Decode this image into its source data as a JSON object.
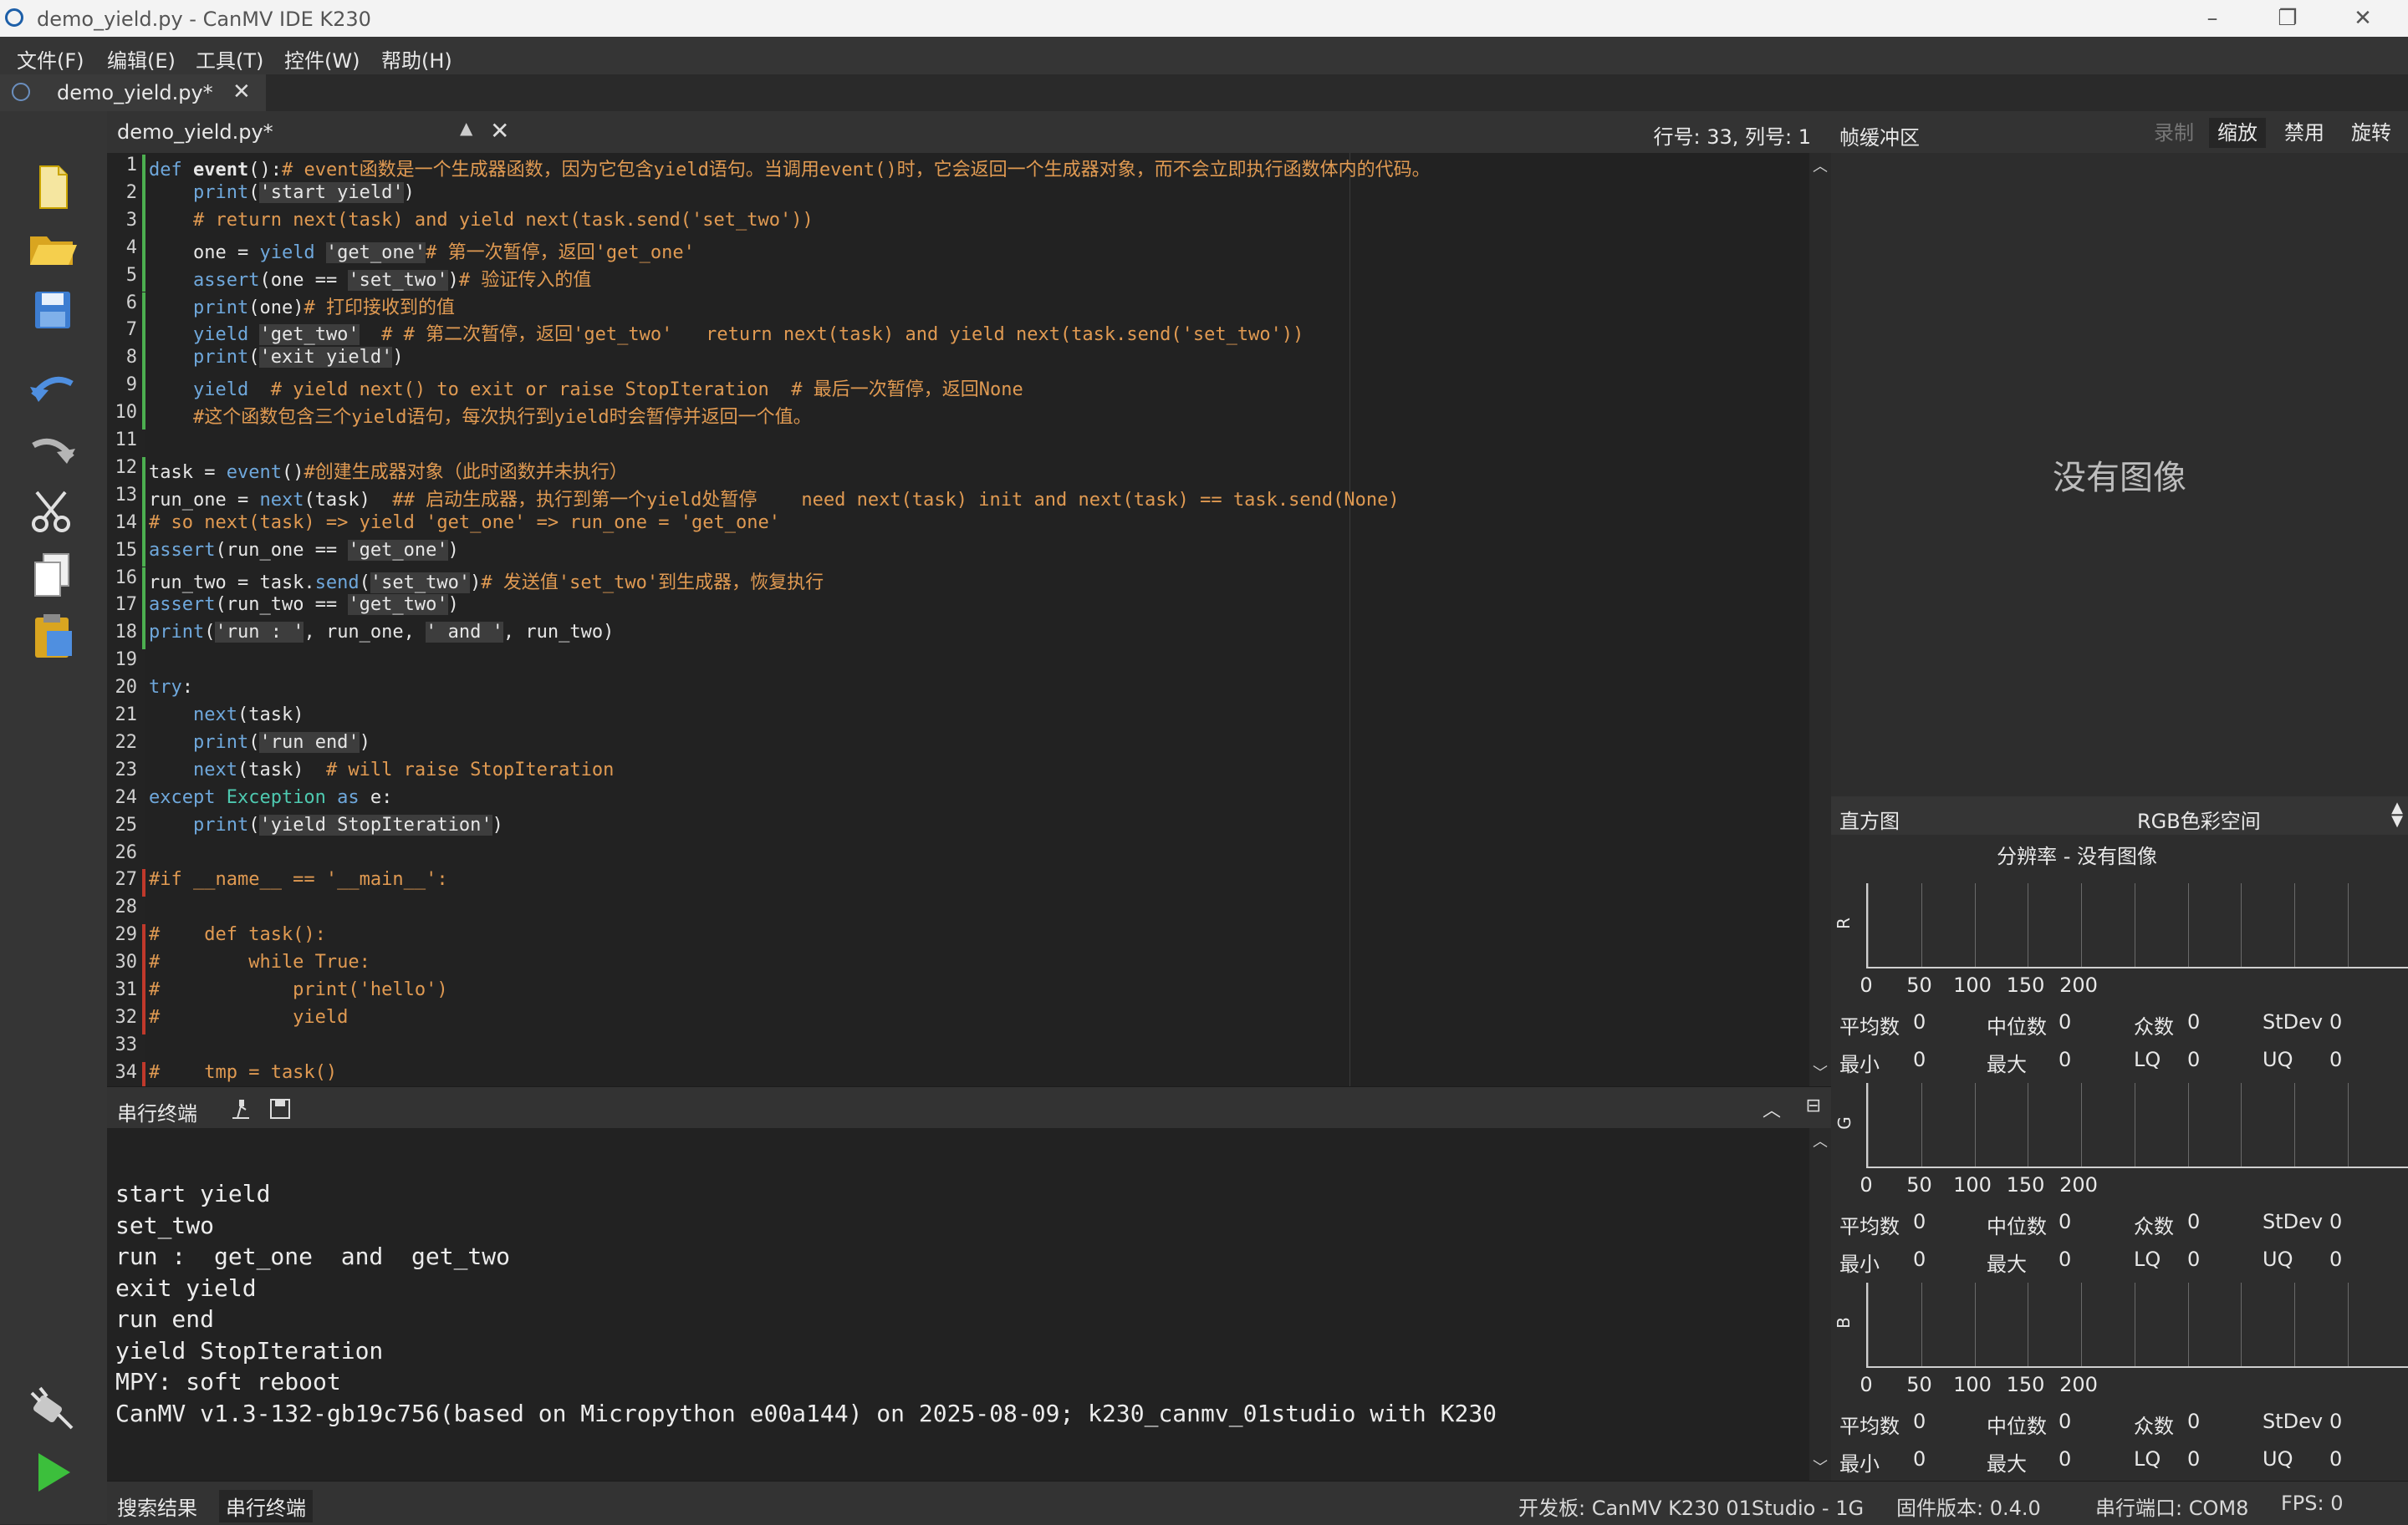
{
  "window": {
    "title": "demo_yield.py - CanMV IDE K230"
  },
  "menu": [
    "文件(F)",
    "编辑(E)",
    "工具(T)",
    "控件(W)",
    "帮助(H)"
  ],
  "file_tab": {
    "label": "demo_yield.py*"
  },
  "editor": {
    "file_name": "demo_yield.py*",
    "position": "行号: 33, 列号: 1",
    "line_numbers": [
      "1",
      "2",
      "3",
      "4",
      "5",
      "6",
      "7",
      "8",
      "9",
      "10",
      "11",
      "12",
      "13",
      "14",
      "15",
      "16",
      "17",
      "18",
      "19",
      "20",
      "21",
      "22",
      "23",
      "24",
      "25",
      "26",
      "27",
      "28",
      "29",
      "30",
      "31",
      "32",
      "33",
      "34"
    ],
    "lines": [
      [
        [
          "kw",
          "def "
        ],
        [
          "fn",
          "event"
        ],
        [
          "",
          "():"
        ],
        [
          "cm",
          "# event函数是一个生成器函数，因为它包含yield语句。当调用event()时，它会返回一个生成器对象，而不会立即执行函数体内的代码。"
        ]
      ],
      [
        [
          "",
          "    "
        ],
        [
          "bi",
          "print"
        ],
        [
          "",
          "("
        ],
        [
          "st",
          "'start yield'"
        ],
        [
          "",
          ")"
        ]
      ],
      [
        [
          "",
          "    "
        ],
        [
          "cm",
          "# return next(task) and yield next(task.send('set_two'))"
        ]
      ],
      [
        [
          "",
          "    one = "
        ],
        [
          "kw",
          "yield "
        ],
        [
          "st",
          "'get_one'"
        ],
        [
          "cm",
          "# 第一次暂停，返回'get_one'"
        ]
      ],
      [
        [
          "",
          "    "
        ],
        [
          "kw",
          "assert"
        ],
        [
          "",
          "(one == "
        ],
        [
          "st",
          "'set_two'"
        ],
        [
          "",
          ")"
        ],
        [
          "cm",
          "# 验证传入的值"
        ]
      ],
      [
        [
          "",
          "    "
        ],
        [
          "bi",
          "print"
        ],
        [
          "",
          "(one)"
        ],
        [
          "cm",
          "# 打印接收到的值"
        ]
      ],
      [
        [
          "",
          "    "
        ],
        [
          "kw",
          "yield "
        ],
        [
          "st",
          "'get_two'"
        ],
        [
          "cm",
          "  # # 第二次暂停，返回'get_two'   return next(task) and yield next(task.send('set_two'))"
        ]
      ],
      [
        [
          "",
          "    "
        ],
        [
          "bi",
          "print"
        ],
        [
          "",
          "("
        ],
        [
          "st",
          "'exit yield'"
        ],
        [
          "",
          ")"
        ]
      ],
      [
        [
          "",
          "    "
        ],
        [
          "kw",
          "yield"
        ],
        [
          "cm",
          "  # yield next() to exit or raise StopIteration  # 最后一次暂停，返回None"
        ]
      ],
      [
        [
          "",
          "    "
        ],
        [
          "cm",
          "#这个函数包含三个yield语句，每次执行到yield时会暂停并返回一个值。"
        ]
      ],
      [],
      [
        [
          "",
          "task = "
        ],
        [
          "bi",
          "event"
        ],
        [
          "",
          "()"
        ],
        [
          "cm",
          "#创建生成器对象（此时函数并未执行）"
        ]
      ],
      [
        [
          "",
          "run_one = "
        ],
        [
          "bi",
          "next"
        ],
        [
          "",
          "(task)  "
        ],
        [
          "cm",
          "## 启动生成器，执行到第一个yield处暂停    need next(task) init and next(task) == task.send(None)"
        ]
      ],
      [
        [
          "cm",
          "# so next(task) => yield 'get_one' => run_one = 'get_one'"
        ]
      ],
      [
        [
          "kw",
          "assert"
        ],
        [
          "",
          "(run_one == "
        ],
        [
          "st",
          "'get_one'"
        ],
        [
          "",
          ")"
        ]
      ],
      [
        [
          "",
          "run_two = task."
        ],
        [
          "bi",
          "send"
        ],
        [
          "",
          "("
        ],
        [
          "st",
          "'set_two'"
        ],
        [
          "",
          ")"
        ],
        [
          "cm",
          "# 发送值'set_two'到生成器，恢复执行"
        ]
      ],
      [
        [
          "kw",
          "assert"
        ],
        [
          "",
          "(run_two == "
        ],
        [
          "st",
          "'get_two'"
        ],
        [
          "",
          ")"
        ]
      ],
      [
        [
          "bi",
          "print"
        ],
        [
          "",
          "("
        ],
        [
          "st",
          "'run : '"
        ],
        [
          "",
          ", run_one, "
        ],
        [
          "st",
          "' and '"
        ],
        [
          "",
          ", run_two)"
        ]
      ],
      [],
      [
        [
          "kw",
          "try"
        ],
        [
          "",
          ":"
        ]
      ],
      [
        [
          "",
          "    "
        ],
        [
          "bi",
          "next"
        ],
        [
          "",
          "(task)"
        ]
      ],
      [
        [
          "",
          "    "
        ],
        [
          "bi",
          "print"
        ],
        [
          "",
          "("
        ],
        [
          "st",
          "'run end'"
        ],
        [
          "",
          ")"
        ]
      ],
      [
        [
          "",
          "    "
        ],
        [
          "bi",
          "next"
        ],
        [
          "",
          "(task)  "
        ],
        [
          "cm",
          "# will raise StopIteration"
        ]
      ],
      [
        [
          "kw",
          "except "
        ],
        [
          "cls",
          "Exception"
        ],
        [
          "kw",
          " as "
        ],
        [
          "",
          "e:"
        ]
      ],
      [
        [
          "",
          "    "
        ],
        [
          "bi",
          "print"
        ],
        [
          "",
          "("
        ],
        [
          "st",
          "'yield StopIteration'"
        ],
        [
          "",
          ")"
        ]
      ],
      [],
      [
        [
          "cm",
          "#if __name__ == '__main__':"
        ]
      ],
      [],
      [
        [
          "cm",
          "#    def task():"
        ]
      ],
      [
        [
          "cm",
          "#        while True:"
        ]
      ],
      [
        [
          "cm",
          "#            print('hello')"
        ]
      ],
      [
        [
          "cm",
          "#            yield"
        ]
      ],
      [],
      [
        [
          "cm",
          "#    tmp = task()"
        ]
      ]
    ]
  },
  "terminal": {
    "title": "串行终端",
    "lines": [
      "start yield",
      "set_two",
      "run :  get_one  and  get_two",
      "exit yield",
      "run end",
      "yield StopIteration",
      "MPY: soft reboot",
      "CanMV v1.3-132-gb19c756(based on Micropython e00a144) on 2025-08-09; k230_canmv_01studio with K230"
    ]
  },
  "status": {
    "tabs": [
      "搜索结果",
      "串行终端"
    ],
    "board": "开发板: CanMV K230 01Studio - 1G",
    "firmware": "固件版本: 0.4.0",
    "port": "串行端口: COM8",
    "fps": "FPS: 0"
  },
  "framebuffer": {
    "title": "帧缓冲区",
    "buttons": [
      "录制",
      "缩放",
      "禁用",
      "旋转"
    ],
    "no_image": "没有图像"
  },
  "histogram": {
    "title": "直方图",
    "colorspace": "RGB色彩空间",
    "resolution": "分辨率 - 没有图像",
    "ticks": [
      "0",
      "50",
      "100",
      "150",
      "200"
    ],
    "channels": [
      {
        "name": "R",
        "stats": {
          "mean": "0",
          "median": "0",
          "mode": "0",
          "stdev": "0",
          "min": "0",
          "max": "0",
          "lq": "0",
          "uq": "0"
        }
      },
      {
        "name": "G",
        "stats": {
          "mean": "0",
          "median": "0",
          "mode": "0",
          "stdev": "0",
          "min": "0",
          "max": "0",
          "lq": "0",
          "uq": "0"
        }
      },
      {
        "name": "B",
        "stats": {
          "mean": "0",
          "median": "0",
          "mode": "0",
          "stdev": "0",
          "min": "0",
          "max": "0",
          "lq": "0",
          "uq": "0"
        }
      }
    ],
    "stat_labels": {
      "mean": "平均数",
      "median": "中位数",
      "mode": "众数",
      "stdev": "StDev",
      "min": "最小",
      "max": "最大",
      "lq": "LQ",
      "uq": "UQ"
    }
  },
  "colors": {
    "accent": "#2e7d32",
    "comment": "#e09a52",
    "keyword": "#6fa8dc",
    "modified_marker": "#4caf50",
    "commented_marker": "#c0392b"
  }
}
